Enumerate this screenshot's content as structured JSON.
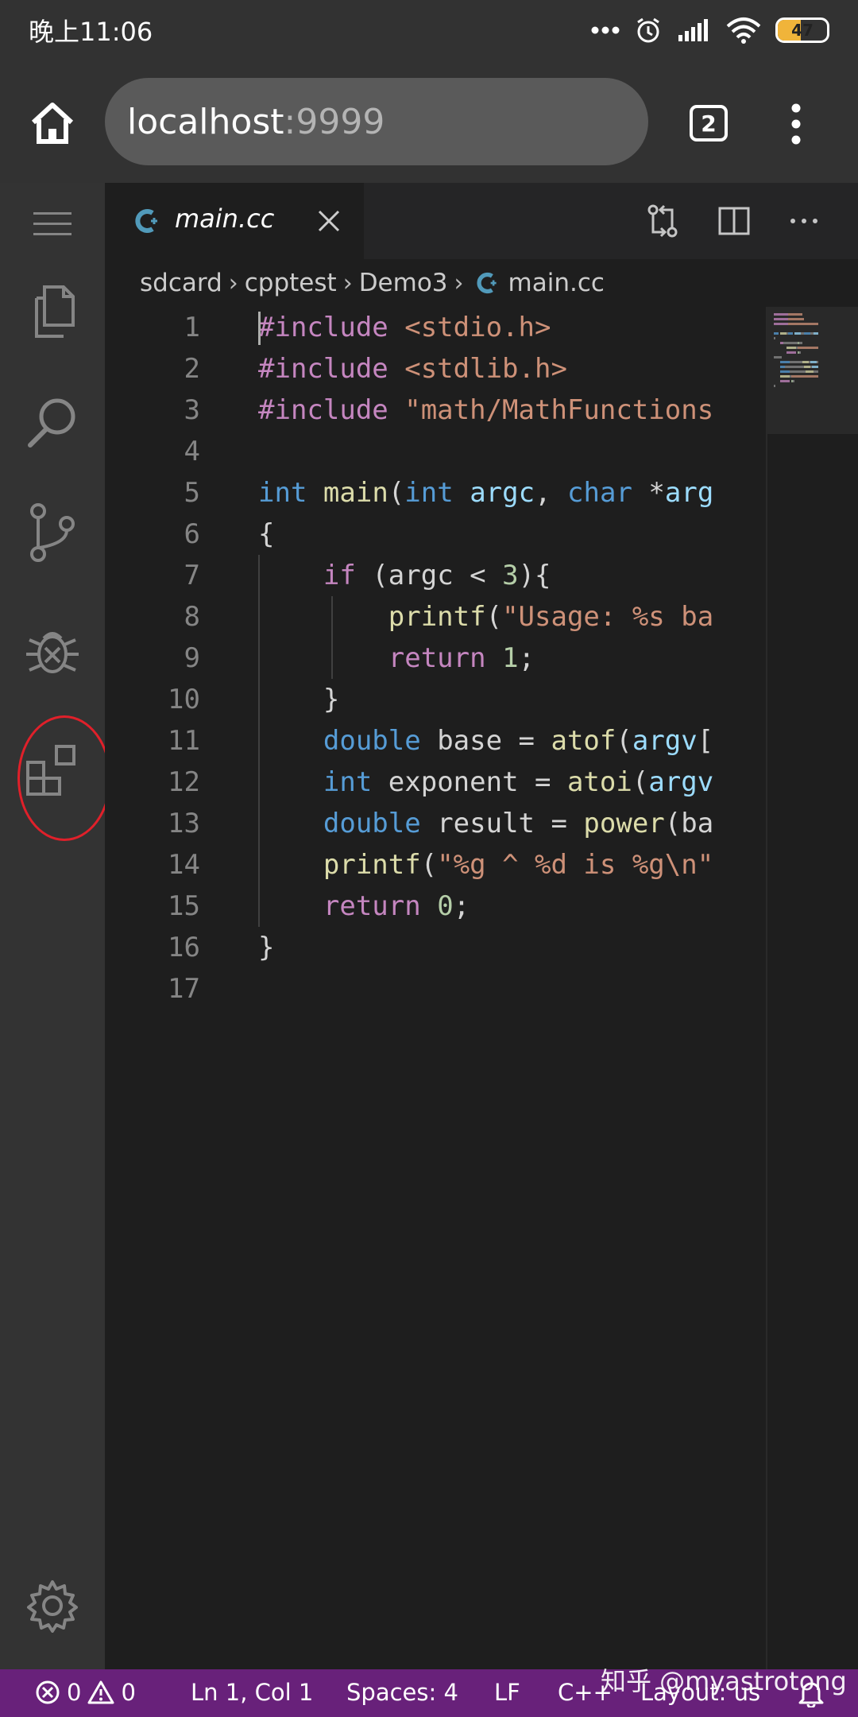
{
  "statusbar": {
    "time": "晚上11:06",
    "battery_level": "47",
    "battery_fraction": 0.47
  },
  "browser": {
    "url_host": "localhost",
    "url_port": ":9999",
    "tab_count": "2"
  },
  "activity_bar": {
    "icons": [
      "menu-icon",
      "explorer-icon",
      "search-icon",
      "source-control-icon",
      "debug-icon",
      "extensions-icon",
      "settings-gear-icon"
    ]
  },
  "editor": {
    "tab_label": "main.cc",
    "breadcrumb": [
      "sdcard",
      "cpptest",
      "Demo3",
      "main.cc"
    ],
    "line_numbers": [
      "1",
      "2",
      "3",
      "4",
      "5",
      "6",
      "7",
      "8",
      "9",
      "10",
      "11",
      "12",
      "13",
      "14",
      "15",
      "16",
      "17"
    ],
    "lines": [
      [
        [
          "pre",
          "#include "
        ],
        [
          "str",
          "<stdio.h>"
        ]
      ],
      [
        [
          "pre",
          "#include "
        ],
        [
          "str",
          "<stdlib.h>"
        ]
      ],
      [
        [
          "pre",
          "#include "
        ],
        [
          "str",
          "\"math/MathFunctions"
        ]
      ],
      [],
      [
        [
          "kw",
          "int"
        ],
        [
          "txt",
          " "
        ],
        [
          "fn",
          "main"
        ],
        [
          "txt",
          "("
        ],
        [
          "kw",
          "int"
        ],
        [
          "txt",
          " "
        ],
        [
          "var",
          "argc"
        ],
        [
          "txt",
          ", "
        ],
        [
          "kw",
          "char"
        ],
        [
          "txt",
          " *"
        ],
        [
          "var",
          "arg"
        ]
      ],
      [
        [
          "txt",
          "{"
        ]
      ],
      [
        [
          "txt",
          "    "
        ],
        [
          "ctl",
          "if"
        ],
        [
          "txt",
          " (argc < "
        ],
        [
          "num",
          "3"
        ],
        [
          "txt",
          "){"
        ]
      ],
      [
        [
          "txt",
          "        "
        ],
        [
          "fn",
          "printf"
        ],
        [
          "txt",
          "("
        ],
        [
          "str",
          "\"Usage: %s ba"
        ]
      ],
      [
        [
          "txt",
          "        "
        ],
        [
          "ctl",
          "return"
        ],
        [
          "txt",
          " "
        ],
        [
          "num",
          "1"
        ],
        [
          "txt",
          ";"
        ]
      ],
      [
        [
          "txt",
          "    }"
        ]
      ],
      [
        [
          "txt",
          "    "
        ],
        [
          "kw",
          "double"
        ],
        [
          "txt",
          " base = "
        ],
        [
          "fn",
          "atof"
        ],
        [
          "txt",
          "("
        ],
        [
          "var",
          "argv"
        ],
        [
          "txt",
          "["
        ]
      ],
      [
        [
          "txt",
          "    "
        ],
        [
          "kw",
          "int"
        ],
        [
          "txt",
          " exponent = "
        ],
        [
          "fn",
          "atoi"
        ],
        [
          "txt",
          "("
        ],
        [
          "var",
          "argv"
        ]
      ],
      [
        [
          "txt",
          "    "
        ],
        [
          "kw",
          "double"
        ],
        [
          "txt",
          " result = "
        ],
        [
          "fn",
          "power"
        ],
        [
          "txt",
          "(ba"
        ]
      ],
      [
        [
          "txt",
          "    "
        ],
        [
          "fn",
          "printf"
        ],
        [
          "txt",
          "("
        ],
        [
          "str",
          "\"%g ^ %d is %g\\n\""
        ]
      ],
      [
        [
          "txt",
          "    "
        ],
        [
          "ctl",
          "return"
        ],
        [
          "txt",
          " "
        ],
        [
          "num",
          "0"
        ],
        [
          "txt",
          ";"
        ]
      ],
      [
        [
          "txt",
          "}"
        ]
      ],
      []
    ]
  },
  "vs_status": {
    "errors": "0",
    "warnings": "0",
    "position": "Ln 1, Col 1",
    "spaces": "Spaces: 4",
    "eol": "LF",
    "language": "C++",
    "layout": "Layout: us"
  },
  "watermark": "知乎 @myastrotong",
  "colors": {
    "status_purple": "#68217a",
    "editor_bg": "#1e1e1e",
    "highlight_ring": "#e0202a"
  }
}
